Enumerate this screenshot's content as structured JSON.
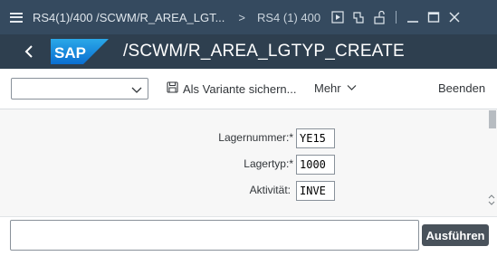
{
  "window": {
    "title": "RS4(1)/400 /SCWM/R_AREA_LGT...",
    "separator": ">",
    "system": "RS4 (1) 400"
  },
  "header": {
    "logo_text": "SAP",
    "transaction": "/SCWM/R_AREA_LGTYP_CREATE"
  },
  "toolbar": {
    "variant_value": "",
    "save_as_variant": "Als Variante sichern...",
    "more": "Mehr",
    "quit": "Beenden"
  },
  "form": {
    "fields": [
      {
        "label": "Lagernummer:",
        "required": "*",
        "value": "YE15"
      },
      {
        "label": "Lagertyp:",
        "required": "*",
        "value": "1000"
      },
      {
        "label": "Aktivität:",
        "required": "",
        "value": "INVE"
      }
    ]
  },
  "footer": {
    "command_value": "",
    "execute": "Ausführen"
  },
  "colors": {
    "titlebar": "#354a5f",
    "header": "#2e3f4f",
    "sap_logo": "#0a6ed1",
    "content_bg": "#f7f7f7",
    "execute_button": "#49525b"
  },
  "icons": [
    "hamburger-icon",
    "play-icon",
    "multi-window-icon",
    "unlock-icon",
    "minimize-icon",
    "maximize-icon",
    "close-icon",
    "back-icon",
    "sap-logo",
    "chevron-down-icon",
    "save-icon",
    "scroll-arrows-icon"
  ]
}
